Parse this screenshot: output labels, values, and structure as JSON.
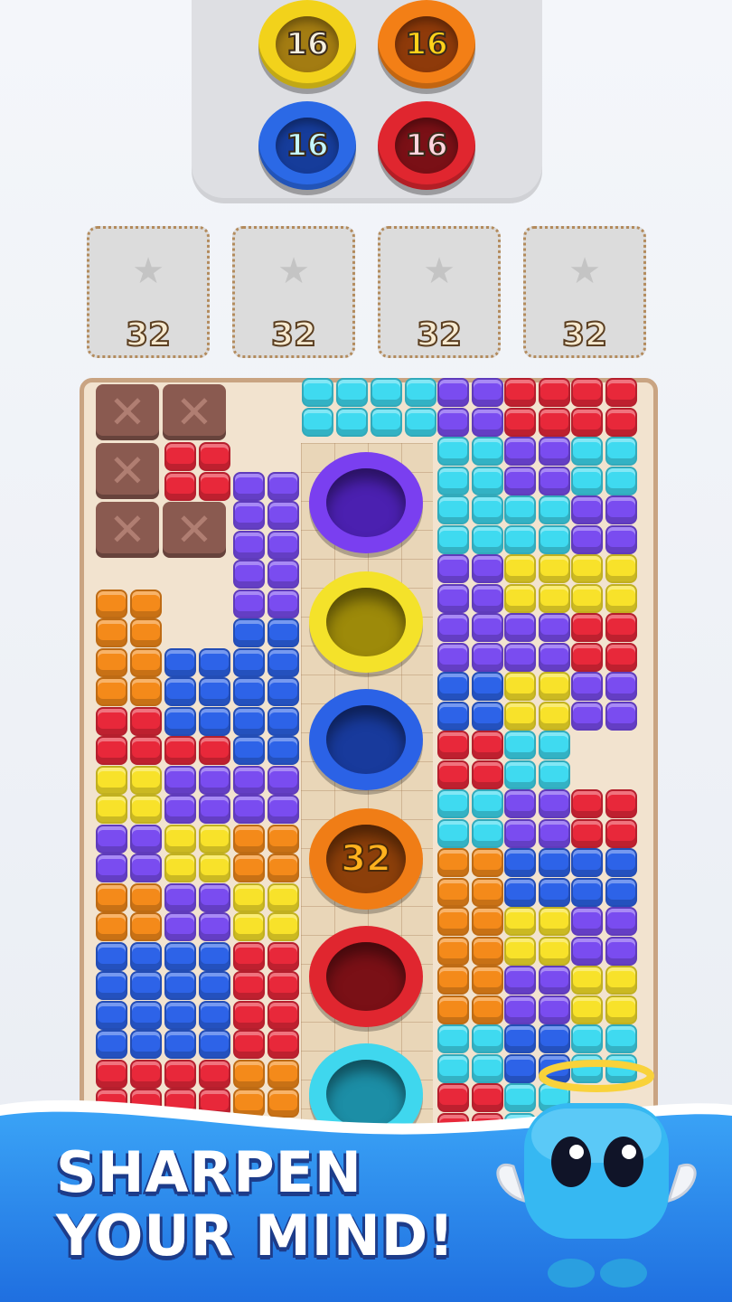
{
  "goals": [
    {
      "count": "16",
      "color": "#f2d21b",
      "inner": "#a37c12",
      "text": "#f4efe0"
    },
    {
      "count": "16",
      "color": "#f37f16",
      "inner": "#8e3a0a",
      "text": "#ffd21a"
    },
    {
      "count": "16",
      "color": "#2b69e6",
      "inner": "#163c9a",
      "text": "#c4f7ff"
    },
    {
      "count": "16",
      "color": "#e0262f",
      "inner": "#7a1016",
      "text": "#ffd5de"
    }
  ],
  "slots": [
    {
      "count": "32"
    },
    {
      "count": "32"
    },
    {
      "count": "32"
    },
    {
      "count": "32"
    }
  ],
  "holes": [
    {
      "color": "#7a3ff0",
      "inner": "#4b20b0",
      "label": ""
    },
    {
      "color": "#f4e22a",
      "inner": "#9d8a0a",
      "label": ""
    },
    {
      "color": "#2b62e6",
      "inner": "#183a9c",
      "label": ""
    },
    {
      "color": "#f07d16",
      "inner": "#8c3f0a",
      "label": "32"
    },
    {
      "color": "#e0262f",
      "inner": "#7a1016",
      "label": ""
    },
    {
      "color": "#3fd7ee",
      "inner": "#1c8ea6",
      "label": ""
    }
  ],
  "colors": {
    "C": "#3fdaf0",
    "P": "#7a4cf0",
    "R": "#e8283a",
    "O": "#f48a1a",
    "Y": "#f8e22a",
    "B": "#2d63e8"
  },
  "tagline": {
    "line1": "SHARPEN",
    "line2": "YOUR MIND!"
  }
}
